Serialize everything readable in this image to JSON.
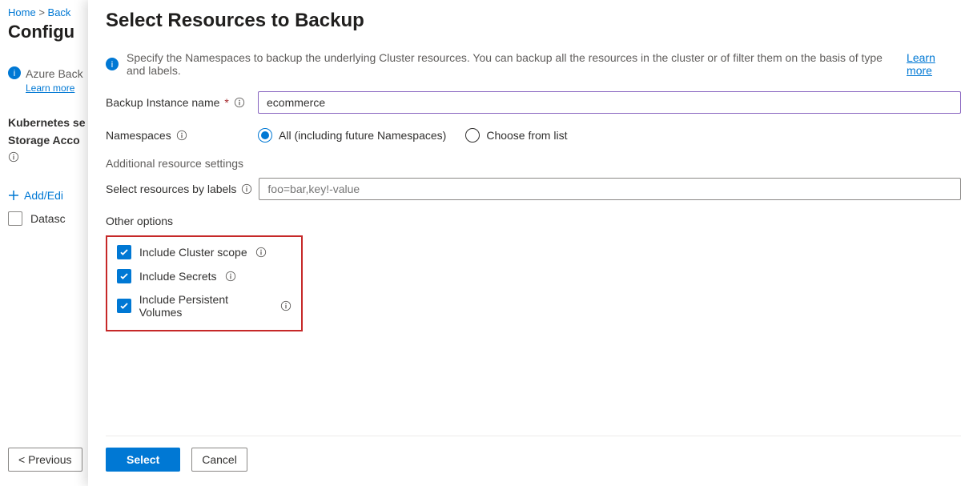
{
  "bg": {
    "breadcrumb_home": "Home",
    "breadcrumb_sep": ">",
    "breadcrumb_back": "Back",
    "title": "Configu",
    "info_text": "Azure Back",
    "learn_more": "Learn more",
    "label_k8s": "Kubernetes se",
    "label_storage": "Storage Acco",
    "addedit": "Add/Edi",
    "datasc": "Datasc",
    "prev_btn": "< Previous"
  },
  "panel": {
    "title": "Select Resources to Backup",
    "info_text": "Specify the Namespaces to backup the underlying Cluster resources. You can backup all the resources in the cluster or of filter them on the basis of type and labels.",
    "learn_more": "Learn more",
    "backup_label": "Backup Instance name",
    "backup_value": "ecommerce",
    "ns_label": "Namespaces",
    "ns_opt_all": "All (including future Namespaces)",
    "ns_opt_choose": "Choose from list",
    "additional_h": "Additional resource settings",
    "labels_label": "Select resources by labels",
    "labels_placeholder": "foo=bar,key!-value",
    "other_h": "Other options",
    "chk_cluster": "Include Cluster scope",
    "chk_secrets": "Include Secrets",
    "chk_pv": "Include Persistent Volumes",
    "select_btn": "Select",
    "cancel_btn": "Cancel"
  }
}
